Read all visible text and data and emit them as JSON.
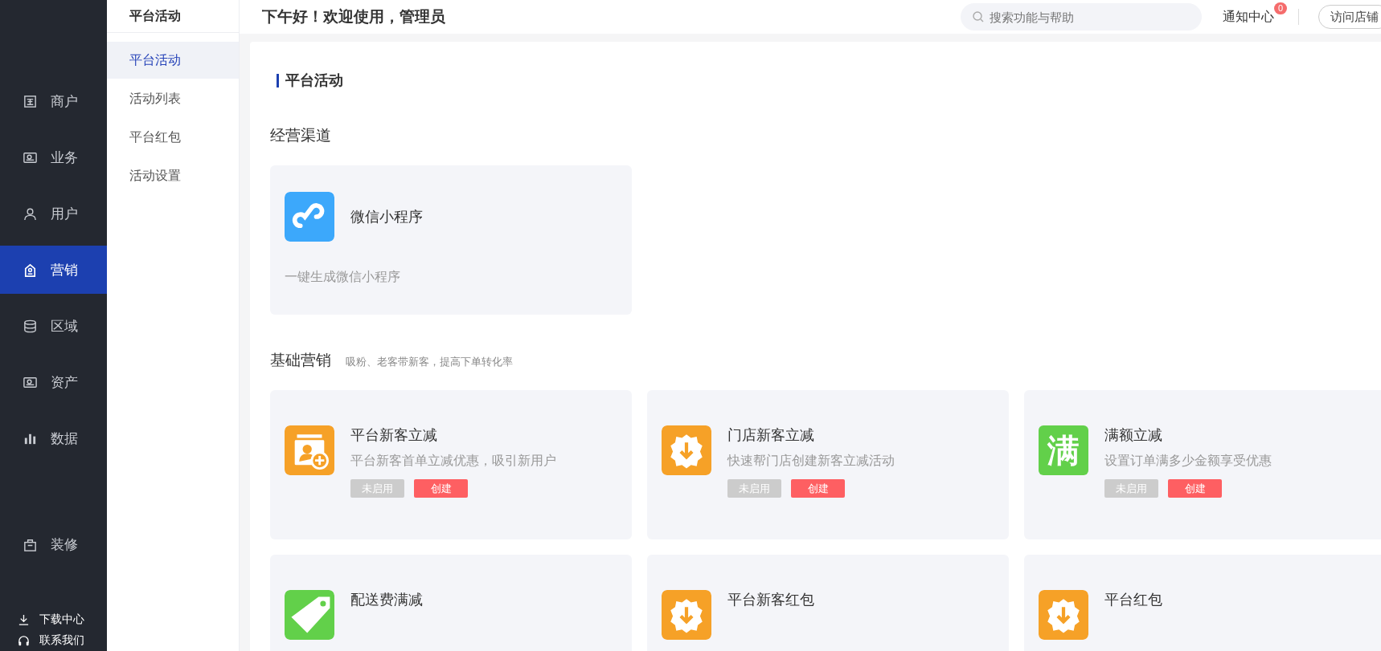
{
  "sidebar": {
    "items": [
      {
        "label": "商户",
        "selected": false
      },
      {
        "label": "业务",
        "selected": false
      },
      {
        "label": "用户",
        "selected": false
      },
      {
        "label": "营销",
        "selected": true
      },
      {
        "label": "区域",
        "selected": false
      },
      {
        "label": "资产",
        "selected": false
      },
      {
        "label": "数据",
        "selected": false
      },
      {
        "label": "装修",
        "selected": false
      }
    ],
    "footer_links": [
      {
        "label": "下载中心"
      },
      {
        "label": "联系我们"
      }
    ]
  },
  "sub_menu": {
    "title": "平台活动",
    "items": [
      {
        "label": "平台活动",
        "selected": true
      },
      {
        "label": "活动列表",
        "selected": false
      },
      {
        "label": "平台红包",
        "selected": false
      },
      {
        "label": "活动设置",
        "selected": false
      }
    ]
  },
  "header": {
    "greeting": "下午好！欢迎使用，管理员",
    "search": {
      "placeholder": "搜索功能与帮助"
    },
    "notifications": {
      "label": "通知中心",
      "badge": "0"
    },
    "visit_store": "访问店铺"
  },
  "page": {
    "title": "平台活动",
    "sections": [
      {
        "title": "经营渠道",
        "kind": "channel",
        "cards": [
          {
            "title": "微信小程序",
            "description": "一键生成微信小程序",
            "color": "#3ca8fb"
          }
        ]
      },
      {
        "title": "基础营销",
        "subtitle": "吸粉、老客带新客，提高下单转化率",
        "kind": "activity",
        "cards": [
          {
            "title": "平台新客立减",
            "description": "平台新客首单立减优惠，吸引新用户",
            "color": "#f6a127",
            "status": "未启用",
            "action": "创建"
          },
          {
            "title": "门店新客立减",
            "description": "快速帮门店创建新客立减活动",
            "color": "#f6a127",
            "status": "未启用",
            "action": "创建"
          },
          {
            "title": "满额立减",
            "description": "设置订单满多少金额享受优惠",
            "color": "#62d04a",
            "icon_glyph": "满",
            "status": "未启用",
            "action": "创建"
          },
          {
            "title": "配送费满减",
            "color": "#62d04a"
          },
          {
            "title": "平台新客红包",
            "color": "#f6a127"
          },
          {
            "title": "平台红包",
            "color": "#f6a127"
          }
        ]
      }
    ]
  }
}
